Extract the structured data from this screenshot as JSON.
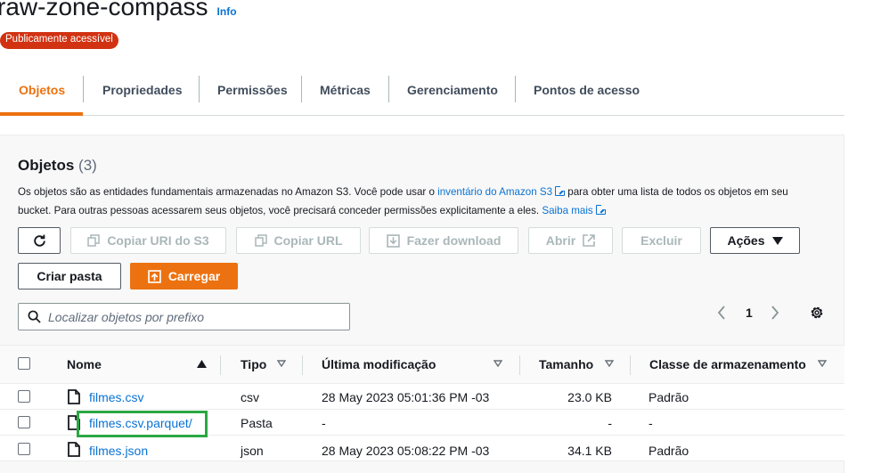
{
  "bucket": {
    "name": "raw-zone-compass",
    "info_label": "Info",
    "access_badge": "Publicamente acessível"
  },
  "tabs": [
    {
      "label": "Objetos",
      "active": true
    },
    {
      "label": "Propriedades",
      "active": false
    },
    {
      "label": "Permissões",
      "active": false
    },
    {
      "label": "Métricas",
      "active": false
    },
    {
      "label": "Gerenciamento",
      "active": false
    },
    {
      "label": "Pontos de acesso",
      "active": false
    }
  ],
  "objects_section": {
    "title": "Objetos",
    "count": "(3)",
    "description_part1": "Os objetos são as entidades fundamentais armazenadas no Amazon S3. Você pode usar o ",
    "inventory_link": "inventário do Amazon S3",
    "description_part2": " para obter uma lista de todos os objetos em seu bucket. Para outras pessoas acessarem seus objetos, você precisará conceder permissões explicitamente a eles. ",
    "learn_more_link": "Saiba mais"
  },
  "toolbar": {
    "copy_uri_label": "Copiar URI do S3",
    "copy_url_label": "Copiar URL",
    "download_label": "Fazer download",
    "open_label": "Abrir",
    "delete_label": "Excluir",
    "actions_label": "Ações",
    "create_folder_label": "Criar pasta",
    "upload_label": "Carregar"
  },
  "search": {
    "placeholder": "Localizar objetos por prefixo"
  },
  "pagination": {
    "current_page": "1"
  },
  "table": {
    "columns": [
      "Nome",
      "Tipo",
      "Última modificação",
      "Tamanho",
      "Classe de armazenamento"
    ],
    "rows": [
      {
        "name": "filmes.csv",
        "type": "csv",
        "modified": "28 May 2023 05:01:36 PM -03",
        "size": "23.0 KB",
        "storage_class": "Padrão",
        "icon": "file-icon"
      },
      {
        "name": "filmes.csv.parquet/",
        "type": "Pasta",
        "modified": "-",
        "size": "-",
        "storage_class": "-",
        "icon": "folder-icon"
      },
      {
        "name": "filmes.json",
        "type": "json",
        "modified": "28 May 2023 05:08:22 PM -03",
        "size": "34.1 KB",
        "storage_class": "Padrão",
        "icon": "file-icon"
      }
    ]
  },
  "colors": {
    "accent": "#ec7211",
    "link": "#0972d3",
    "badge": "#d13212",
    "highlight": "#2aa843"
  }
}
